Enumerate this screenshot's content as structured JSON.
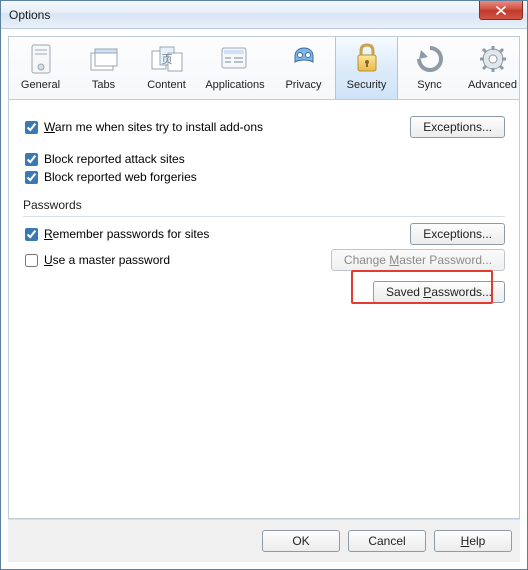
{
  "window": {
    "title": "Options"
  },
  "tabs": {
    "general": "General",
    "tabs": "Tabs",
    "content": "Content",
    "applications": "Applications",
    "privacy": "Privacy",
    "security": "Security",
    "sync": "Sync",
    "advanced": "Advanced"
  },
  "security": {
    "warn_install_pre": "Warn me when sites try to install add-ons",
    "block_attack": "Block reported attack sites",
    "block_forgeries": "Block reported web forgeries",
    "exceptions1": "Exceptions...",
    "passwords_group": "Passwords",
    "remember_pw": "Remember passwords for sites",
    "exceptions2": "Exceptions...",
    "use_master": "Use a master password",
    "change_master": "Change Master Password...",
    "saved_pw": "Saved Passwords..."
  },
  "footer": {
    "ok": "OK",
    "cancel": "Cancel",
    "help": "Help"
  }
}
